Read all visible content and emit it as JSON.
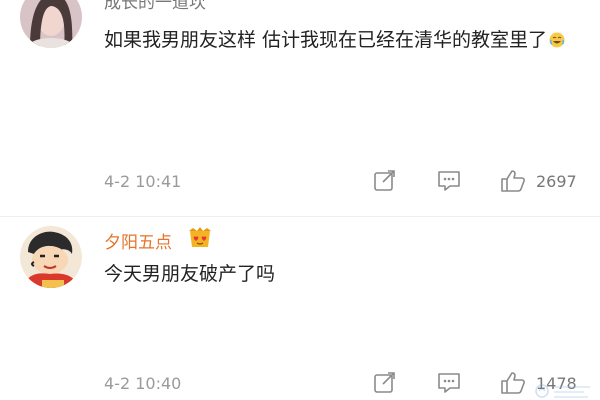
{
  "comments": [
    {
      "username": "成长的一道坎",
      "content": "如果我男朋友这样 估计我现在已经在清华的教室里了",
      "time": "4-2 10:41",
      "likes": "2697",
      "emoji_icon": "laugh-cry-emoji-icon"
    },
    {
      "username": "夕阳五点",
      "content": "今天男朋友破产了吗",
      "time": "4-2 10:40",
      "likes": "1478",
      "badge_icon": "heart-eyes-badge-icon"
    }
  ],
  "colors": {
    "username_gray": "#777777",
    "username_orange": "#e6742a",
    "meta_gray": "#9a9a9a",
    "badge_gold": "#f5b324"
  }
}
